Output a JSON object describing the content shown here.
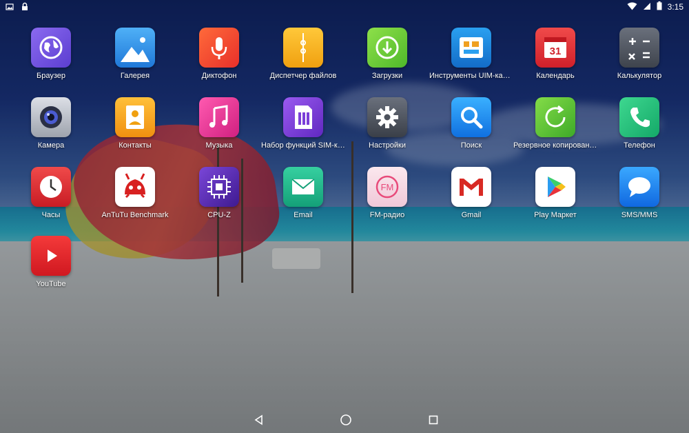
{
  "status_bar": {
    "time": "3:15",
    "left_icons": [
      "image-notification-icon",
      "lock-icon"
    ],
    "right_icons": [
      "wifi-icon",
      "signal-icon",
      "battery-icon"
    ]
  },
  "apps": [
    {
      "label": "Браузер",
      "icon": "globe-icon",
      "color": "#6b4fd6"
    },
    {
      "label": "Галерея",
      "icon": "gallery-icon",
      "color": "#2f8fe8"
    },
    {
      "label": "Диктофон",
      "icon": "microphone-icon",
      "color": "#f04a2a"
    },
    {
      "label": "Диспетчер файлов",
      "icon": "folder-icon",
      "color": "#f2b21a"
    },
    {
      "label": "Загрузки",
      "icon": "download-icon",
      "color": "#6fc833"
    },
    {
      "label": "Инструменты UIM-карты",
      "icon": "sim-tools-icon",
      "color": "#1d88e0"
    },
    {
      "label": "Календарь",
      "icon": "calendar-icon",
      "color": "#e8333a"
    },
    {
      "label": "Калькулятор",
      "icon": "calculator-icon",
      "color": "#555a66"
    },
    {
      "label": "Камера",
      "icon": "camera-icon",
      "color": "#b8bcc6"
    },
    {
      "label": "Контакты",
      "icon": "contacts-icon",
      "color": "#f5a91c"
    },
    {
      "label": "Музыка",
      "icon": "music-icon",
      "color": "#e8389a"
    },
    {
      "label": "Набор функций SIM-карты",
      "icon": "sim-toolkit-icon",
      "color": "#7b3fd8"
    },
    {
      "label": "Настройки",
      "icon": "gear-icon",
      "color": "#4d525c"
    },
    {
      "label": "Поиск",
      "icon": "search-icon",
      "color": "#1e8ff0"
    },
    {
      "label": "Резервное копирование...",
      "icon": "backup-icon",
      "color": "#5fc43a"
    },
    {
      "label": "Телефон",
      "icon": "phone-icon",
      "color": "#22c07a"
    },
    {
      "label": "Часы",
      "icon": "clock-icon",
      "color": "#e8333a"
    },
    {
      "label": "AnTuTu Benchmark",
      "icon": "antutu-icon",
      "color": "#ffffff"
    },
    {
      "label": "CPU-Z",
      "icon": "cpu-icon",
      "color": "#5a2cb0"
    },
    {
      "label": "Email",
      "icon": "email-icon",
      "color": "#24b58a"
    },
    {
      "label": "FM-радио",
      "icon": "fm-radio-icon",
      "color": "#f7dce6"
    },
    {
      "label": "Gmail",
      "icon": "gmail-icon",
      "color": "#ffffff"
    },
    {
      "label": "Play Маркет",
      "icon": "play-store-icon",
      "color": "#ffffff"
    },
    {
      "label": "SMS/MMS",
      "icon": "messages-icon",
      "color": "#1e86ee"
    },
    {
      "label": "YouTube",
      "icon": "youtube-icon",
      "color": "#e8222a"
    }
  ],
  "nav_bar": {
    "buttons": [
      "back-icon",
      "home-icon",
      "recents-icon"
    ]
  }
}
